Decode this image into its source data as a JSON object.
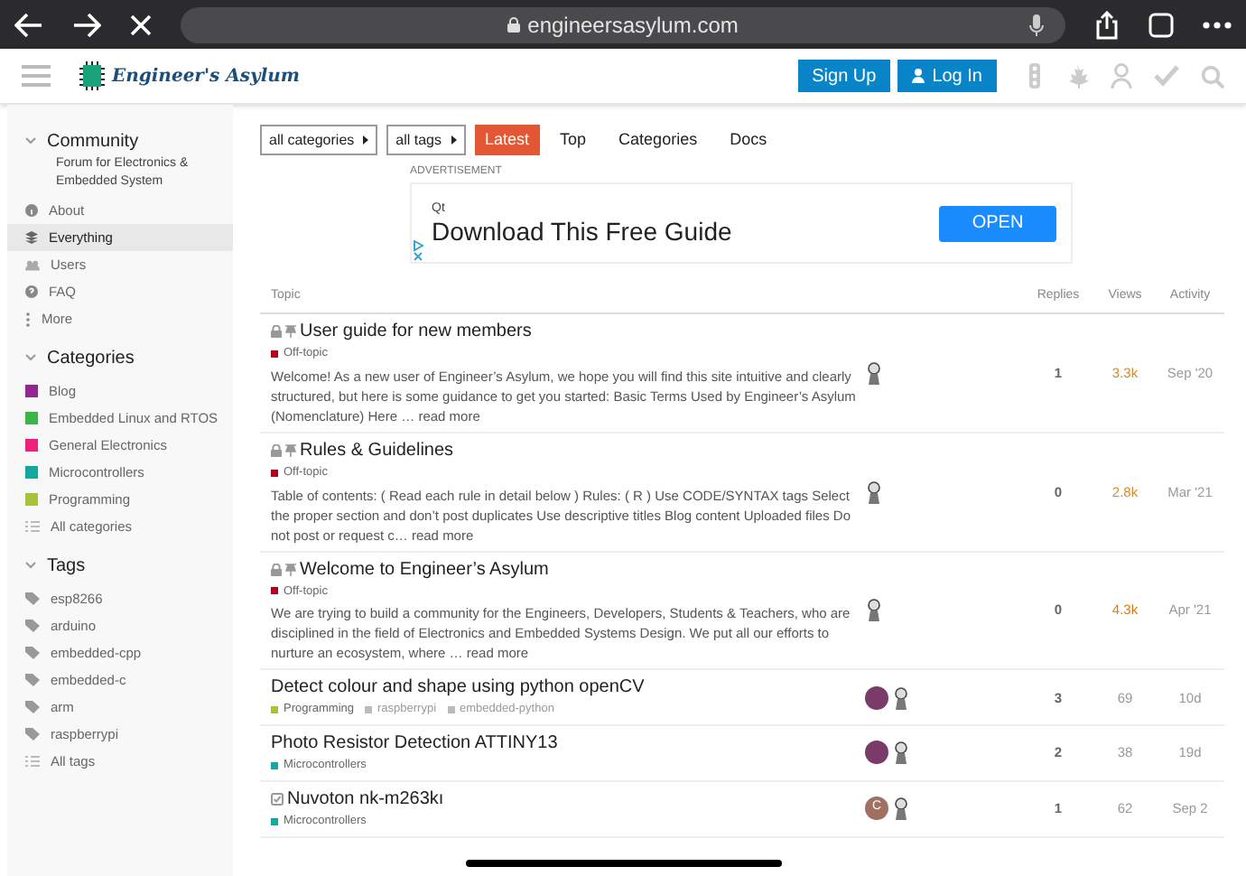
{
  "browser": {
    "url": "engineersasylum.com"
  },
  "header": {
    "logo_text": "Engineer's Asylum",
    "buttons": [
      {
        "label": "Sign Up",
        "kind": "signup"
      },
      {
        "label": "Log In",
        "kind": "login"
      }
    ]
  },
  "sidebar": {
    "sections": [
      {
        "title": "Community",
        "expanded": true,
        "subtitle": "Forum for Electronics & Embedded System",
        "items": [
          {
            "label": "About",
            "kind": "about",
            "selected": false
          },
          {
            "label": "Everything",
            "kind": "everything",
            "selected": true
          },
          {
            "label": "Users",
            "kind": "users",
            "selected": false
          },
          {
            "label": "FAQ",
            "kind": "faq",
            "selected": false
          },
          {
            "label": "More",
            "kind": "more",
            "selected": false
          }
        ]
      },
      {
        "title": "Categories",
        "expanded": true,
        "items": [
          {
            "label": "Blog",
            "kind": "category",
            "color": "#92278f",
            "selected": false
          },
          {
            "label": "Embedded Linux and RTOS",
            "kind": "category",
            "color": "#3ab54a",
            "selected": false
          },
          {
            "label": "General Electronics",
            "kind": "category",
            "color": "#ed207b",
            "selected": false
          },
          {
            "label": "Microcontrollers",
            "kind": "category",
            "color": "#12a89d",
            "selected": false
          },
          {
            "label": "Programming",
            "kind": "category",
            "color": "#a6c33b",
            "selected": false
          },
          {
            "label": "All categories",
            "kind": "all",
            "selected": false
          }
        ]
      },
      {
        "title": "Tags",
        "expanded": true,
        "items": [
          {
            "label": "esp8266",
            "kind": "tag",
            "selected": false
          },
          {
            "label": "arduino",
            "kind": "tag",
            "selected": false
          },
          {
            "label": "embedded-cpp",
            "kind": "tag",
            "selected": false
          },
          {
            "label": "embedded-c",
            "kind": "tag",
            "selected": false
          },
          {
            "label": "arm",
            "kind": "tag",
            "selected": false
          },
          {
            "label": "raspberrypi",
            "kind": "tag",
            "selected": false
          },
          {
            "label": "All tags",
            "kind": "all",
            "selected": false
          }
        ]
      }
    ]
  },
  "filters": [
    {
      "label": "all categories"
    },
    {
      "label": "all tags"
    }
  ],
  "nav_tabs": [
    {
      "label": "Latest",
      "selected": true
    },
    {
      "label": "Top",
      "selected": false
    },
    {
      "label": "Categories",
      "selected": false
    },
    {
      "label": "Docs",
      "selected": false
    }
  ],
  "ad": {
    "label": "ADVERTISEMENT",
    "advertiser": "Qt",
    "headline": "Download This Free Guide",
    "button": "OPEN"
  },
  "table": {
    "columns": [
      "Topic",
      "Replies",
      "Views",
      "Activity"
    ],
    "rows": [
      {
        "title": "User guide for new members",
        "locked": true,
        "pinned": true,
        "solved": false,
        "category": {
          "name": "Off-topic",
          "color": "#b3001b"
        },
        "tags": [],
        "excerpt": "Welcome! As a new user of Engineer’s Asylum, we hope you will find this site intuitive and clearly structured, but here is some guidance to get you started: Basic Terms Used by Engineer’s Asylum (Nomenclature) Here …",
        "read_more": "read more",
        "posters": [
          {
            "kind": "figure"
          }
        ],
        "replies": "1",
        "views": {
          "text": "3.3k",
          "color": "#d08a35"
        },
        "activity": "Sep '20"
      },
      {
        "title": "Rules & Guidelines",
        "locked": true,
        "pinned": true,
        "solved": false,
        "category": {
          "name": "Off-topic",
          "color": "#b3001b"
        },
        "tags": [],
        "excerpt": "Table of contents: ( Read each rule in detail below ) Rules: ( R ) Use CODE/SYNTAX tags Select the proper section and don’t post duplicates Use descriptive titles Blog content Uploaded files Do not post or request c…",
        "read_more": "read more",
        "posters": [
          {
            "kind": "figure"
          }
        ],
        "replies": "0",
        "views": {
          "text": "2.8k",
          "color": "#d9892a"
        },
        "activity": "Mar '21"
      },
      {
        "title": "Welcome to Engineer’s Asylum",
        "locked": true,
        "pinned": true,
        "solved": false,
        "category": {
          "name": "Off-topic",
          "color": "#b3001b"
        },
        "tags": [],
        "excerpt": "We are trying to build a community for the Engineers, Developers, Students & Teachers, who are disciplined in the field of Electronics and Embedded Systems Design. We put all our efforts to nurture an ecosystem, where …",
        "read_more": "read more",
        "posters": [
          {
            "kind": "figure"
          }
        ],
        "replies": "0",
        "views": {
          "text": "4.3k",
          "color": "#e07b0e"
        },
        "activity": "Apr '21"
      },
      {
        "title": "Detect colour and shape using python openCV",
        "locked": false,
        "pinned": false,
        "solved": false,
        "category": {
          "name": "Programming",
          "color": "#a6c33b"
        },
        "tags": [
          "raspberrypi",
          "embedded-python"
        ],
        "posters": [
          {
            "kind": "photo"
          },
          {
            "kind": "figure"
          }
        ],
        "replies": "3",
        "views": {
          "text": "69",
          "color": "#999999"
        },
        "activity": "10d"
      },
      {
        "title": "Photo Resistor Detection ATTINY13",
        "locked": false,
        "pinned": false,
        "solved": false,
        "category": {
          "name": "Microcontrollers",
          "color": "#12a89d"
        },
        "tags": [],
        "posters": [
          {
            "kind": "photo"
          },
          {
            "kind": "figure"
          }
        ],
        "replies": "2",
        "views": {
          "text": "38",
          "color": "#999999"
        },
        "activity": "19d"
      },
      {
        "title": "Nuvoton nk-m263kı",
        "locked": false,
        "pinned": false,
        "solved": true,
        "category": {
          "name": "Microcontrollers",
          "color": "#12a89d"
        },
        "tags": [],
        "posters": [
          {
            "kind": "letter",
            "letter": "C"
          },
          {
            "kind": "figure"
          }
        ],
        "replies": "1",
        "views": {
          "text": "62",
          "color": "#999999"
        },
        "activity": "Sep 2"
      }
    ]
  }
}
